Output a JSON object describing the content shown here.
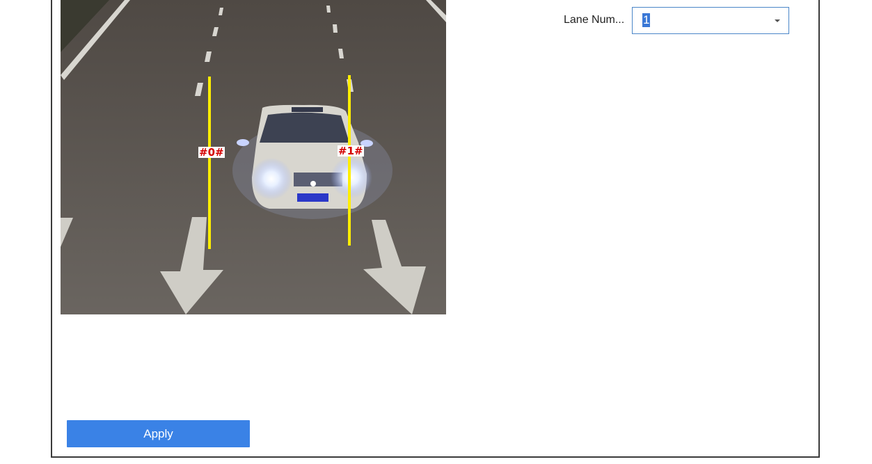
{
  "video": {
    "lines": [
      {
        "label": "#0#",
        "color": "#ffee00"
      },
      {
        "label": "#1#",
        "color": "#ffee00"
      }
    ]
  },
  "lane_settings": {
    "label": "Lane Num...",
    "selected": "1"
  },
  "actions": {
    "apply_label": "Apply"
  },
  "colors": {
    "accent": "#3a82e6",
    "select_border": "#4a86c8",
    "line": "#ffee00",
    "tag_text": "#d40000"
  }
}
